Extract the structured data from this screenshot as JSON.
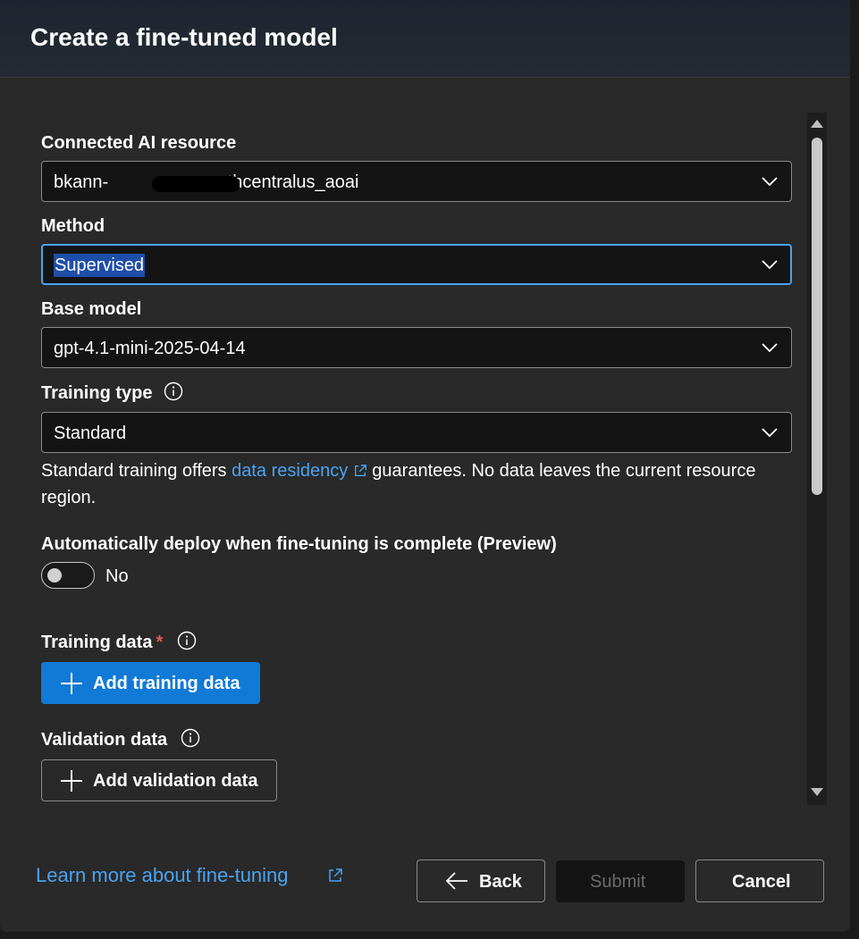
{
  "dialog": {
    "title": "Create a fine-tuned model"
  },
  "connected_resource": {
    "label": "Connected AI resource",
    "value_prefix": "bkann-",
    "value_suffix": "-northcentralus_aoai"
  },
  "method": {
    "label": "Method",
    "value": "Supervised"
  },
  "base_model": {
    "label": "Base model",
    "value": "gpt-4.1-mini-2025-04-14"
  },
  "training_type": {
    "label": "Training type",
    "value": "Standard",
    "description_before": "Standard training offers ",
    "description_link": "data residency",
    "description_after": " guarantees. No data leaves the current resource region."
  },
  "auto_deploy": {
    "label": "Automatically deploy when fine-tuning is complete (Preview)",
    "state_label": "No",
    "enabled": false
  },
  "training_data": {
    "label": "Training data",
    "required_marker": "*",
    "button_label": "Add training data"
  },
  "validation_data": {
    "label": "Validation data",
    "button_label": "Add validation data"
  },
  "footer": {
    "learn_more": "Learn more about fine-tuning",
    "back": "Back",
    "submit": "Submit",
    "cancel": "Cancel"
  },
  "colors": {
    "accent": "#117ad6",
    "link": "#4aa3f0",
    "focus_border": "#4aa3f0",
    "required": "#e05a5a"
  },
  "icons": [
    "chevron-down-icon",
    "info-icon",
    "external-link-icon",
    "plus-icon",
    "arrow-left-icon"
  ]
}
